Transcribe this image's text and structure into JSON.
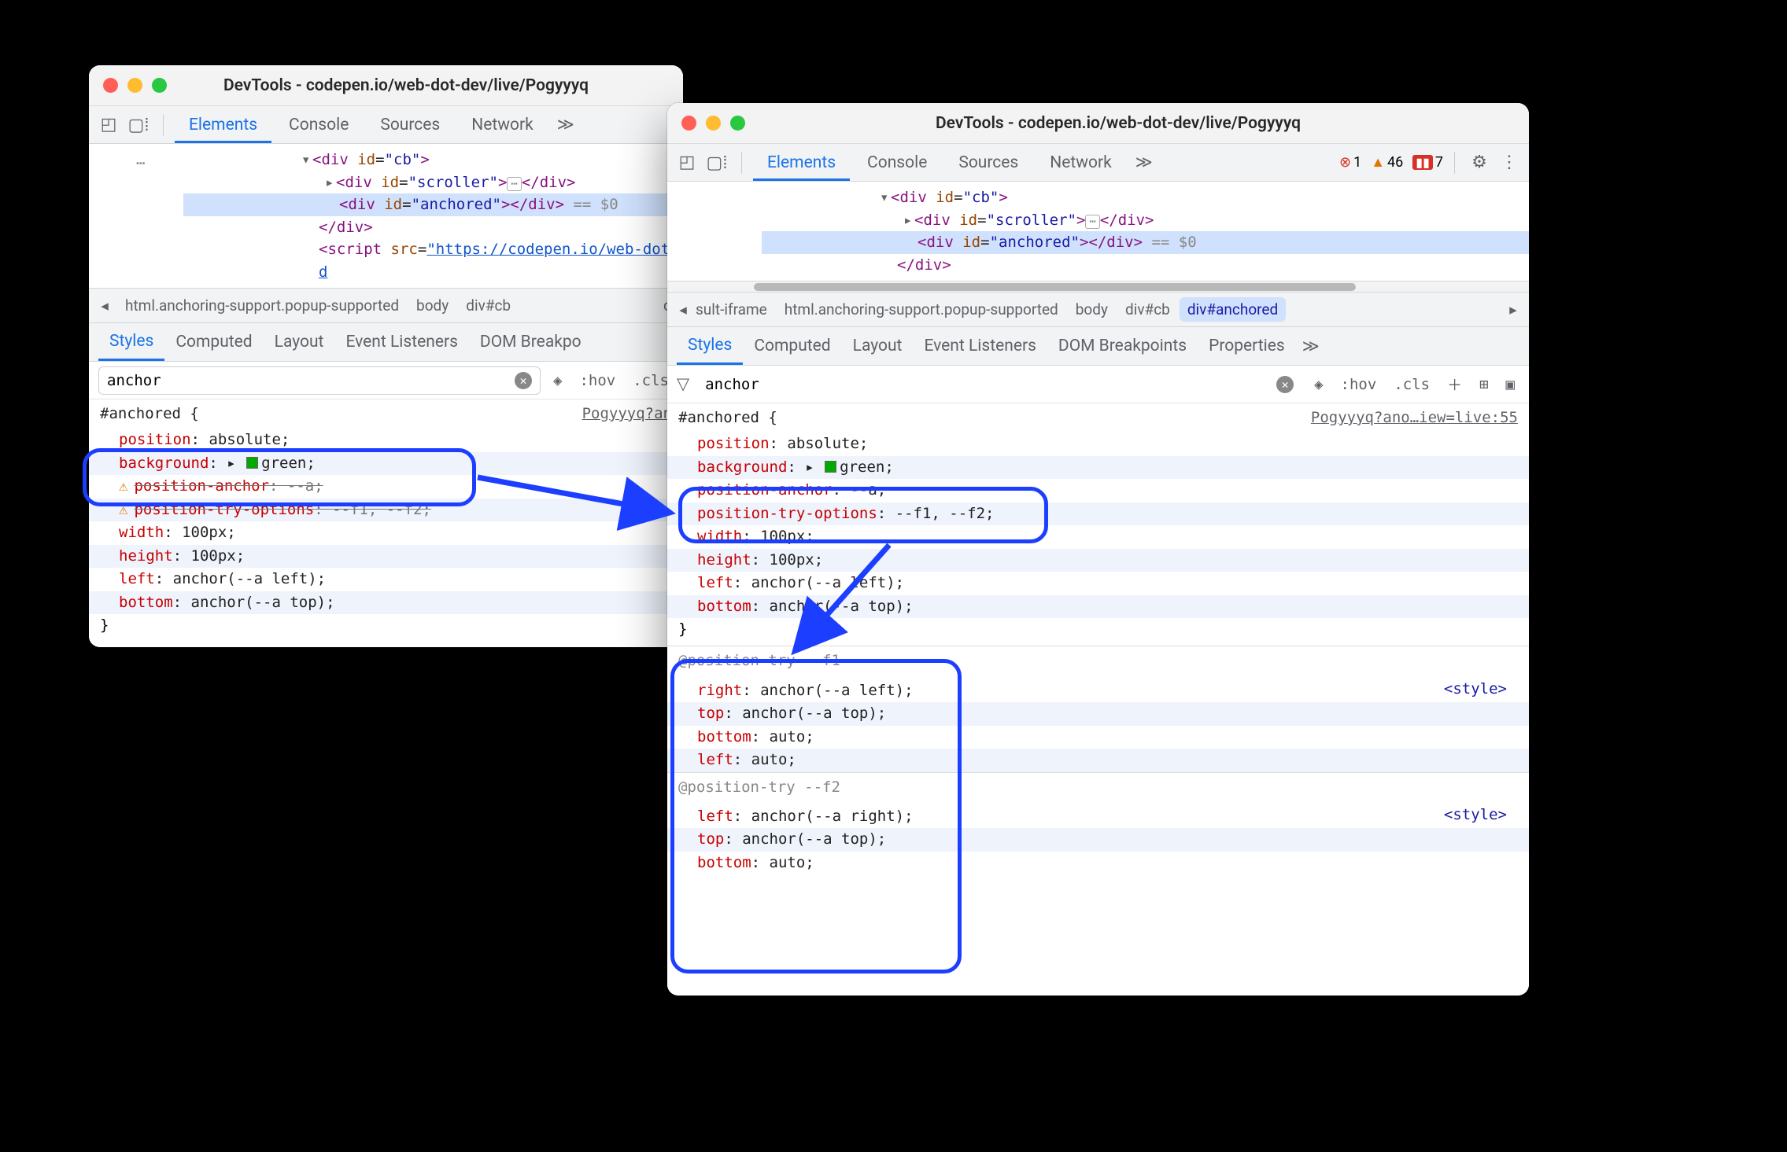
{
  "window_title": "DevTools - codepen.io/web-dot-dev/live/Pogyyyq",
  "main_tabs": [
    "Elements",
    "Console",
    "Sources",
    "Network"
  ],
  "sub_tabs": [
    "Styles",
    "Computed",
    "Layout",
    "Event Listeners",
    "DOM Breakpoints",
    "Properties"
  ],
  "filter_text": "anchor",
  "toolbar": {
    "hov": ":hov",
    "cls": ".cls"
  },
  "errors": {
    "red": "1",
    "yellow": "46",
    "badge": "7"
  },
  "elements_left": {
    "ellipsis": "…",
    "l1a": "<div id=\"cb\">",
    "l2_open": "<div id=",
    "l2_attr": "\"scroller\"",
    "l2_mid": ">",
    "l2_dots": "…",
    "l2_close": "</div>",
    "l3_open": "<div id=",
    "l3_attr_full": "\"anchored\"",
    "l3_close": "></div>",
    "l3_tail": " == $0",
    "l4": "</div>",
    "l5a": "<script src=",
    "l5b": "\"https://codepen.io/web-dot-d"
  },
  "elements_right": {
    "l1a": "<div id=\"cb\">",
    "l2_open": "<div id=",
    "l2_attr": "\"scroller\"",
    "l2_mid": ">",
    "l2_dots": "…",
    "l2_close": "</div>",
    "l3_open": "<div id=",
    "l3_attr_full": "\"anchored\"",
    "l3_close": "></div>",
    "l3_tail": " == $0",
    "l4": "</div>"
  },
  "crumbs_left": [
    "html.anchoring-support.popup-supported",
    "body",
    "div#cb"
  ],
  "crumbs_right_prefix": "sult-iframe",
  "crumbs_right": [
    "html.anchoring-support.popup-supported",
    "body",
    "div#cb",
    "div#anchored"
  ],
  "styles_left": {
    "selector": "#anchored {",
    "src": "Pogyyyq?an",
    "decls": [
      {
        "p": "position",
        "v": ": absolute;",
        "alt": false
      },
      {
        "p": "background",
        "v": ": ▸ ",
        "swatch": true,
        "v2": "green;",
        "alt": true
      },
      {
        "p": "position-anchor",
        "v": ": --a;",
        "alt": false,
        "warn": true,
        "strike": true
      },
      {
        "p": "position-try-options",
        "v": ": --f1, --f2;",
        "alt": true,
        "warn": true,
        "strike": true
      },
      {
        "p": "width",
        "v": ": 100px;",
        "alt": false
      },
      {
        "p": "height",
        "v": ": 100px;",
        "alt": true
      },
      {
        "p": "left",
        "v": ": anchor(--a left);",
        "alt": false
      },
      {
        "p": "bottom",
        "v": ": anchor(--a top);",
        "alt": true
      }
    ],
    "close": "}"
  },
  "styles_right": {
    "selector": "#anchored {",
    "src": "Pogyyyq?ano…iew=live:55",
    "decls": [
      {
        "p": "position",
        "v": ": absolute;",
        "alt": false
      },
      {
        "p": "background",
        "v": ": ▸ ",
        "swatch": true,
        "v2": "green;",
        "alt": true
      },
      {
        "p": "position-anchor",
        "v": ": --a;",
        "alt": false,
        "hl": true
      },
      {
        "p": "position-try-options",
        "v": ": --f1, --f2;",
        "alt": true,
        "hl": true
      },
      {
        "p": "width",
        "v": ": 100px;",
        "alt": false
      },
      {
        "p": "height",
        "v": ": 100px;",
        "alt": true
      },
      {
        "p": "left",
        "v": ": anchor(--a left);",
        "alt": false
      },
      {
        "p": "bottom",
        "v": ": anchor(--a top);",
        "alt": true
      }
    ],
    "close": "}",
    "try1": {
      "hdr": "@position-try --f1",
      "src": "<style>",
      "d": [
        {
          "p": "right",
          "v": ": anchor(--a left);",
          "alt": false
        },
        {
          "p": "top",
          "v": ": anchor(--a top);",
          "alt": true
        },
        {
          "p": "bottom",
          "v": ": auto;",
          "alt": false
        },
        {
          "p": "left",
          "v": ": auto;",
          "alt": true
        }
      ]
    },
    "try2": {
      "hdr": "@position-try --f2",
      "src": "<style>",
      "d": [
        {
          "p": "left",
          "v": ": anchor(--a right);",
          "alt": false
        },
        {
          "p": "top",
          "v": ": anchor(--a top);",
          "alt": true
        },
        {
          "p": "bottom",
          "v": ": auto;",
          "alt": false
        }
      ]
    }
  }
}
